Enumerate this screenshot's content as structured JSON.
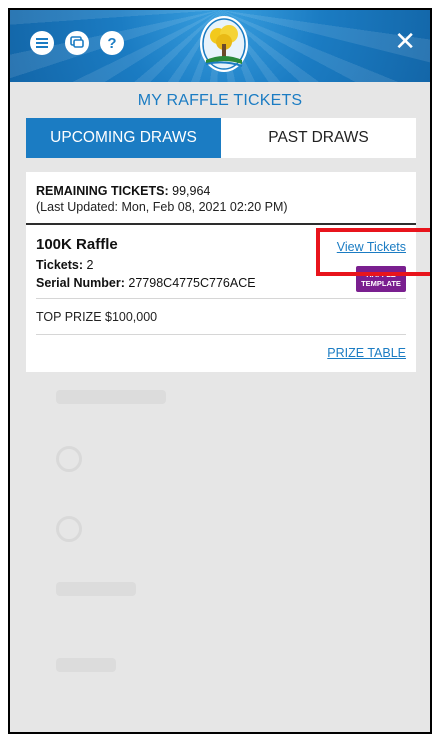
{
  "header": {
    "icons": [
      "menu-icon",
      "chat-icon",
      "help-icon",
      "close-icon"
    ],
    "help_glyph": "?",
    "close_glyph": "✕",
    "colors": {
      "primary": "#1b7cc3",
      "highlight": "#e8141c",
      "badge": "#7a1f8f"
    }
  },
  "page": {
    "title": "MY RAFFLE TICKETS"
  },
  "tabs": [
    {
      "label": "UPCOMING DRAWS",
      "active": true
    },
    {
      "label": "PAST DRAWS",
      "active": false
    }
  ],
  "summary": {
    "remaining_label": "REMAINING TICKETS:",
    "remaining_value": "99,964",
    "last_updated": "(Last Updated: Mon, Feb 08, 2021 02:20 PM)"
  },
  "raffle": {
    "name": "100K Raffle",
    "view_link": "View Tickets",
    "tickets_label": "Tickets:",
    "tickets_value": "2",
    "serial_label": "Serial Number:",
    "serial_value": "27798C4775C776ACE",
    "badge_line1": "RAFFLE",
    "badge_line2": "TEMPLATE",
    "top_prize": "TOP PRIZE $100,000",
    "prize_table_link": "PRIZE TABLE"
  }
}
